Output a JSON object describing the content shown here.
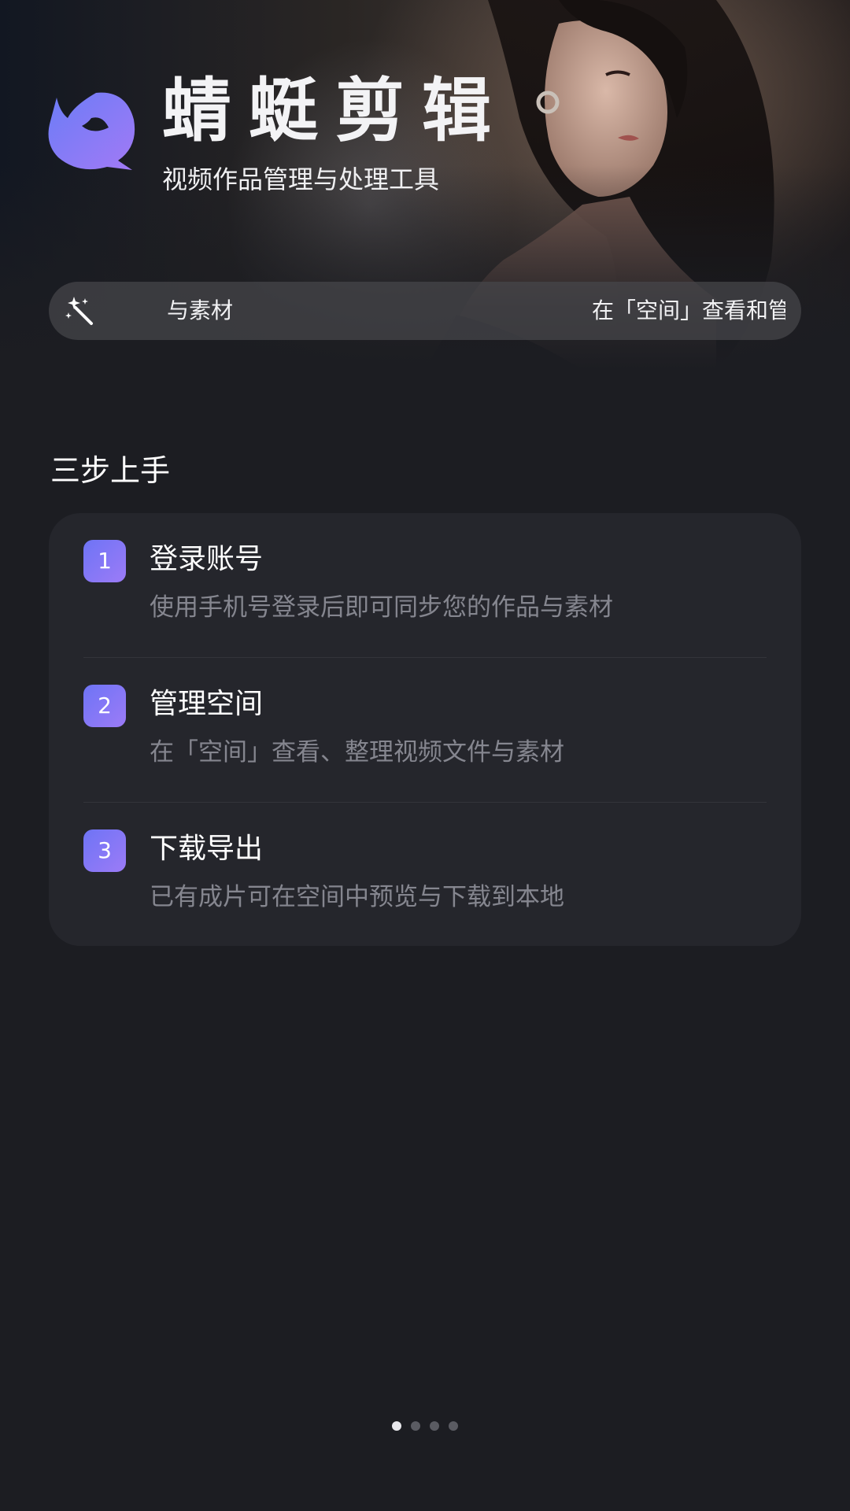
{
  "app": {
    "title": "蜻蜓剪辑",
    "subtitle": "视频作品管理与处理工具"
  },
  "ticker": {
    "icon": "magic-wand-icon",
    "text_left": "与素材",
    "text_right": "在「空间」查看和管"
  },
  "steps_section": {
    "title": "三步上手",
    "steps": [
      {
        "number": "1",
        "title": "登录账号",
        "description": "使用手机号登录后即可同步您的作品与素材"
      },
      {
        "number": "2",
        "title": "管理空间",
        "description": "在「空间」查看、整理视频文件与素材"
      },
      {
        "number": "3",
        "title": "下载导出",
        "description": "已有成片可在空间中预览与下载到本地"
      }
    ]
  },
  "pager": {
    "count": 4,
    "active_index": 0
  },
  "colors": {
    "background": "#1c1d22",
    "card": "#25262c",
    "accent_start": "#6e74f5",
    "accent_end": "#9c7bf7",
    "muted_text": "#85868f"
  }
}
